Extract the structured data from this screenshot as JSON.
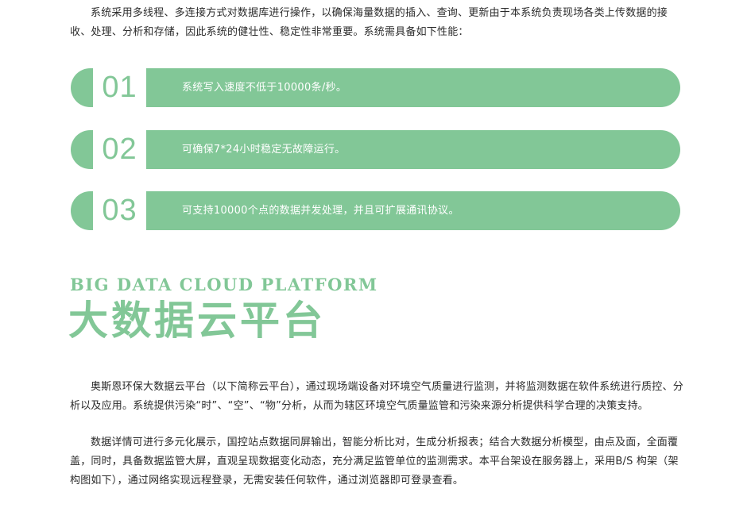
{
  "intro": "系统采用多线程、多连接方式对数据库进行操作，以确保海量数据的插入、查询、更新由于本系统负责现场各类上传数据的接收、处理、分析和存储，因此系统的健壮性、稳定性非常重要。系统需具备如下性能：",
  "features": [
    {
      "number": "01",
      "text": "系统写入速度不低于10000条/秒。"
    },
    {
      "number": "02",
      "text": "可确保7*24小时稳定无故障运行。"
    },
    {
      "number": "03",
      "text": "可支持10000个点的数据并发处理，并且可扩展通讯协议。"
    }
  ],
  "section": {
    "en_title": "BIG DATA CLOUD PLATFORM",
    "cn_title": "大数据云平台"
  },
  "paragraphs": [
    "奥斯恩环保大数据云平台（以下简称云平台），通过现场端设备对环境空气质量进行监测，并将监测数据在软件系统进行质控、分析以及应用。系统提供污染“时”、“空”、“物”分析，从而为辖区环境空气质量监管和污染来源分析提供科学合理的决策支持。",
    "数据详情可进行多元化展示，国控站点数据同屏输出，智能分析比对，生成分析报表；结合大数据分析模型，由点及面，全面覆盖，同时，具备数据监管大屏，直观呈现数据变化动态，充分满足监管单位的监测需求。本平台架设在服务器上，采用B/S 构架（架构图如下），通过网络实现远程登录，无需安装任何软件，通过浏览器即可登录查看。"
  ],
  "colors": {
    "accent": "#82c797",
    "text": "#2b2b2b",
    "background": "#ffffff"
  }
}
